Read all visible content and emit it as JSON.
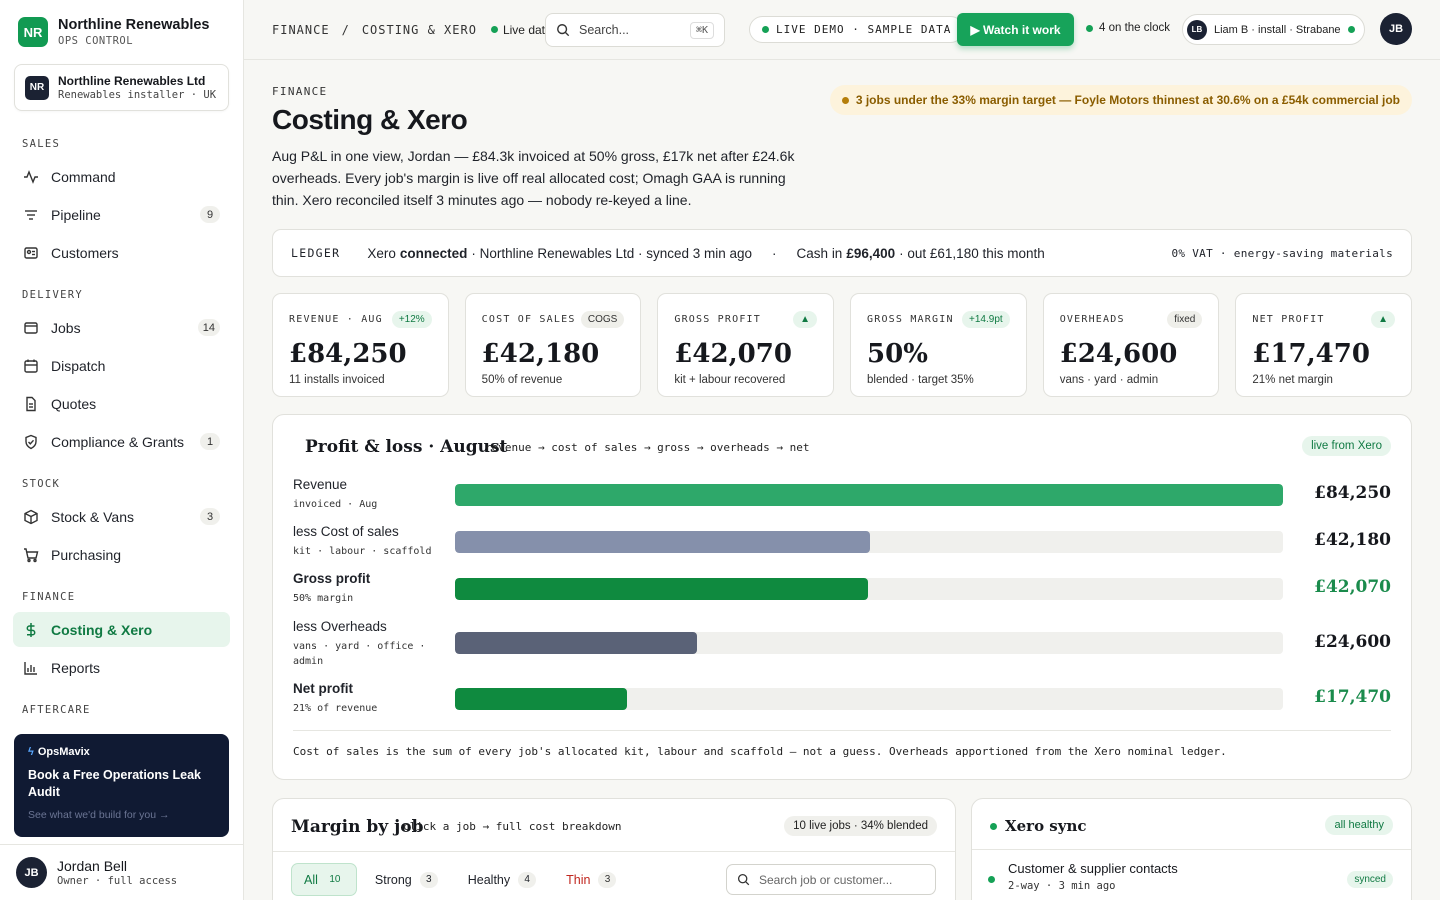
{
  "sidebar": {
    "brand": {
      "logo": "NR",
      "name": "Northline Renewables",
      "sub": "OPS CONTROL"
    },
    "org": {
      "logo": "NR",
      "name": "Northline Renewables Ltd",
      "sub": "Renewables installer · UK"
    },
    "sections": {
      "sales": "SALES",
      "delivery": "DELIVERY",
      "stock": "STOCK",
      "finance": "FINANCE",
      "aftercare": "AFTERCARE"
    },
    "items": {
      "command": {
        "label": "Command",
        "icon": "pulse-icon"
      },
      "pipeline": {
        "label": "Pipeline",
        "count": "9",
        "icon": "filter-lines-icon"
      },
      "customers": {
        "label": "Customers",
        "icon": "contact-card-icon"
      },
      "jobs": {
        "label": "Jobs",
        "count": "14",
        "icon": "browser-window-icon"
      },
      "dispatch": {
        "label": "Dispatch",
        "icon": "calendar-icon"
      },
      "quotes": {
        "label": "Quotes",
        "icon": "document-icon"
      },
      "compliance": {
        "label": "Compliance & Grants",
        "count": "1",
        "icon": "shield-check-icon"
      },
      "stock": {
        "label": "Stock & Vans",
        "count": "3",
        "icon": "box-icon"
      },
      "purchasing": {
        "label": "Purchasing",
        "icon": "cart-icon"
      },
      "costing": {
        "label": "Costing & Xero",
        "icon": "dollar-icon"
      },
      "reports": {
        "label": "Reports",
        "icon": "bar-chart-icon"
      }
    },
    "promo": {
      "brand": "OpsMavix",
      "title": "Book a Free Operations Leak Audit",
      "sub": "See what we'd build for you →"
    },
    "user": {
      "initials": "JB",
      "name": "Jordan Bell",
      "role": "Owner · full access"
    }
  },
  "topbar": {
    "crumb_1": "FINANCE",
    "crumb_sep": "/",
    "crumb_2": "COSTING & XERO",
    "live": "Live data",
    "search_placeholder": "Search...",
    "search_kbd": "⌘K",
    "demo": "LIVE DEMO · SAMPLE DATA",
    "watch": "▶ Watch it work",
    "clock": "4 on the clock",
    "tech_initials": "LB",
    "tech_label": "Liam B · install · Strabane",
    "me": "JB"
  },
  "header": {
    "eyebrow": "FINANCE",
    "title": "Costing & Xero",
    "intro": "Aug P&L in one view, Jordan — £84.3k invoiced at 50% gross, £17k net after £24.6k overheads. Every job's margin is live off real allocated cost; Omagh GAA is running thin. Xero reconciled itself 3 minutes ago — nobody re-keyed a line.",
    "alert": "3 jobs under the 33% margin target — Foyle Motors thinnest at 30.6% on a £54k commercial job"
  },
  "ledger": {
    "label": "LEDGER",
    "xero": "Xero",
    "status": "connected",
    "detail": "· Northline Renewables Ltd · synced 3 min ago",
    "bullet": "·",
    "cash_in_label": "Cash in",
    "cash_in": "£96,400",
    "cash_out": "· out £61,180 this month",
    "vat": "0% VAT · energy-saving materials"
  },
  "kpis": [
    {
      "label": "REVENUE · AUG",
      "badge": "+12%",
      "value": "£84,250",
      "sub": "11 installs invoiced"
    },
    {
      "label": "COST OF SALES",
      "badge": "COGS",
      "value": "£42,180",
      "sub": "50% of revenue"
    },
    {
      "label": "GROSS PROFIT",
      "badge": "▲",
      "value": "£42,070",
      "sub": "kit + labour recovered"
    },
    {
      "label": "GROSS MARGIN",
      "badge": "+14.9pt",
      "value": "50%",
      "sub": "blended · target 35%"
    },
    {
      "label": "OVERHEADS",
      "badge": "fixed",
      "value": "£24,600",
      "sub": "vans · yard · admin"
    },
    {
      "label": "NET PROFIT",
      "badge": "▲",
      "value": "£17,470",
      "sub": "21% net margin"
    }
  ],
  "pl": {
    "title": "Profit & loss · August",
    "flow": "revenue → cost of sales → gross → overheads → net",
    "live": "live from Xero",
    "max": 84250,
    "rows": [
      {
        "label": "Revenue",
        "sub": "invoiced · Aug",
        "value": 84250,
        "display": "£84,250",
        "color": "#2ea86a",
        "val_color": "#16181d"
      },
      {
        "label": "less Cost of sales",
        "sub": "kit · labour · scaffold",
        "value": 42180,
        "display": "£42,180",
        "color": "#8590ab",
        "val_color": "#16181d"
      },
      {
        "label": "Gross profit",
        "sub": "50% margin",
        "value": 42070,
        "display": "£42,070",
        "color": "#0f8a3f",
        "val_color": "#1a8b4c"
      },
      {
        "label": "less Overheads",
        "sub": "vans · yard · office · admin",
        "value": 24600,
        "display": "£24,600",
        "color": "#5a6277",
        "val_color": "#16181d"
      },
      {
        "label": "Net profit",
        "sub": "21% of revenue",
        "value": 17470,
        "display": "£17,470",
        "color": "#0f8a3f",
        "val_color": "#1a8b4c"
      }
    ],
    "note": "Cost of sales is the sum of every job's allocated kit, labour and scaffold — not a guess. Overheads apportioned from the Xero nominal ledger."
  },
  "margin": {
    "title": "Margin by job",
    "hint": "click a job → full cost breakdown",
    "badge": "10 live jobs · 34% blended",
    "filters": [
      {
        "label": "All",
        "count": "10"
      },
      {
        "label": "Strong",
        "count": "3"
      },
      {
        "label": "Healthy",
        "count": "4"
      },
      {
        "label": "Thin",
        "count": "3"
      }
    ],
    "search_placeholder": "Search job or customer..."
  },
  "xero": {
    "title": "Xero sync",
    "badge": "all healthy",
    "row_name": "Customer & supplier contacts",
    "row_sub": "2-way · 3 min ago",
    "row_tag": "synced"
  },
  "colors": {
    "accent": "#17a35a",
    "accent_soft": "#e7f5ec",
    "warn": "#8a5d00",
    "thin": "#c0271f",
    "navy": "#1b2233"
  }
}
